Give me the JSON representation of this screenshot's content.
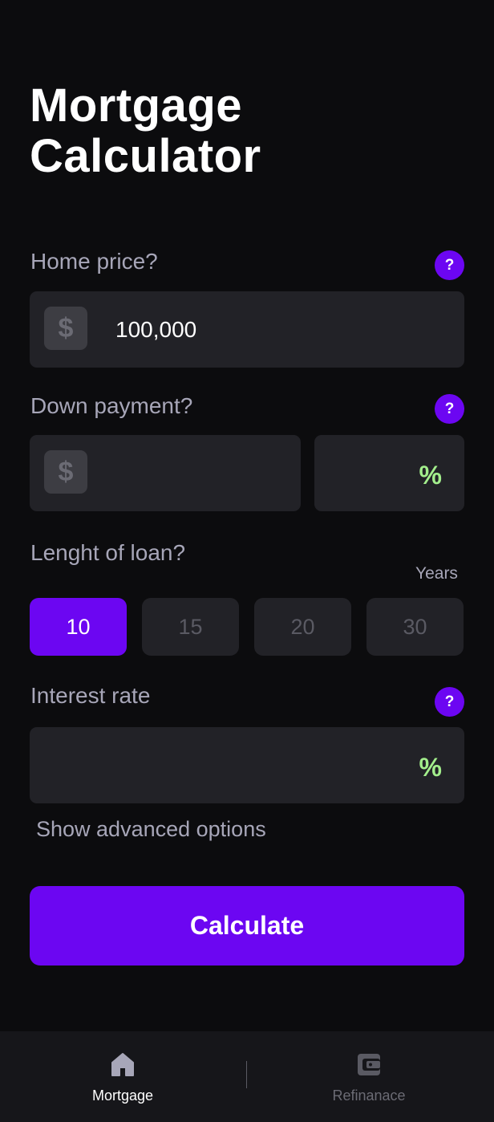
{
  "header": {
    "title_line1": "Mortgage",
    "title_line2": "Calculator"
  },
  "home_price": {
    "label": "Home price?",
    "help": "?",
    "currency": "$",
    "value": "100,000"
  },
  "down_payment": {
    "label": "Down payment?",
    "help": "?",
    "currency": "$",
    "amount": "",
    "percent_symbol": "%"
  },
  "loan_length": {
    "label": "Lenght of loan?",
    "unit": "Years",
    "options": [
      "10",
      "15",
      "20",
      "30"
    ],
    "selected": "10"
  },
  "interest_rate": {
    "label": "Interest rate",
    "help": "?",
    "value": "",
    "percent_symbol": "%"
  },
  "advanced_link": "Show advanced options",
  "calculate_button": "Calculate",
  "tabbar": {
    "items": [
      {
        "label": "Mortgage",
        "icon": "home-icon",
        "active": true
      },
      {
        "label": "Refinanace",
        "icon": "wallet-icon",
        "active": false
      }
    ]
  },
  "colors": {
    "accent": "#6c06f2",
    "percent": "#a3ee8c",
    "background": "#0c0c0e",
    "field": "#222227"
  }
}
